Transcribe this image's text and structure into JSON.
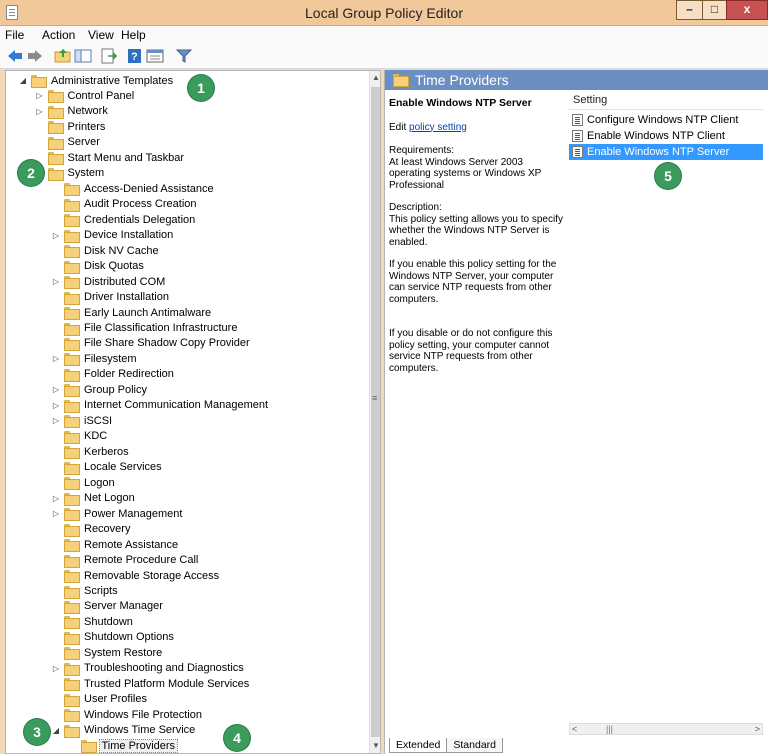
{
  "window": {
    "title": "Local Group Policy Editor"
  },
  "menu": [
    "File",
    "Action",
    "View",
    "Help"
  ],
  "toolbar": {
    "icons": [
      "back-arrow-icon",
      "forward-arrow-icon",
      "up-folder-icon",
      "show-hide-tree-icon",
      "export-list-icon",
      "help-icon",
      "properties-icon",
      "filter-icon"
    ]
  },
  "tree": [
    {
      "label": "Administrative Templates",
      "depth": 0,
      "expander": "expanded"
    },
    {
      "label": "Control Panel",
      "depth": 1,
      "expander": "collapsed"
    },
    {
      "label": "Network",
      "depth": 1,
      "expander": "collapsed"
    },
    {
      "label": "Printers",
      "depth": 1,
      "expander": ""
    },
    {
      "label": "Server",
      "depth": 1,
      "expander": ""
    },
    {
      "label": "Start Menu and Taskbar",
      "depth": 1,
      "expander": ""
    },
    {
      "label": "System",
      "depth": 1,
      "expander": "expanded"
    },
    {
      "label": "Access-Denied Assistance",
      "depth": 2,
      "expander": ""
    },
    {
      "label": "Audit Process Creation",
      "depth": 2,
      "expander": ""
    },
    {
      "label": "Credentials Delegation",
      "depth": 2,
      "expander": ""
    },
    {
      "label": "Device Installation",
      "depth": 2,
      "expander": "collapsed"
    },
    {
      "label": "Disk NV Cache",
      "depth": 2,
      "expander": ""
    },
    {
      "label": "Disk Quotas",
      "depth": 2,
      "expander": ""
    },
    {
      "label": "Distributed COM",
      "depth": 2,
      "expander": "collapsed"
    },
    {
      "label": "Driver Installation",
      "depth": 2,
      "expander": ""
    },
    {
      "label": "Early Launch Antimalware",
      "depth": 2,
      "expander": ""
    },
    {
      "label": "File Classification Infrastructure",
      "depth": 2,
      "expander": ""
    },
    {
      "label": "File Share Shadow Copy Provider",
      "depth": 2,
      "expander": ""
    },
    {
      "label": "Filesystem",
      "depth": 2,
      "expander": "collapsed"
    },
    {
      "label": "Folder Redirection",
      "depth": 2,
      "expander": ""
    },
    {
      "label": "Group Policy",
      "depth": 2,
      "expander": "collapsed"
    },
    {
      "label": "Internet Communication Management",
      "depth": 2,
      "expander": "collapsed"
    },
    {
      "label": "iSCSI",
      "depth": 2,
      "expander": "collapsed"
    },
    {
      "label": "KDC",
      "depth": 2,
      "expander": ""
    },
    {
      "label": "Kerberos",
      "depth": 2,
      "expander": ""
    },
    {
      "label": "Locale Services",
      "depth": 2,
      "expander": ""
    },
    {
      "label": "Logon",
      "depth": 2,
      "expander": ""
    },
    {
      "label": "Net Logon",
      "depth": 2,
      "expander": "collapsed"
    },
    {
      "label": "Power Management",
      "depth": 2,
      "expander": "collapsed"
    },
    {
      "label": "Recovery",
      "depth": 2,
      "expander": ""
    },
    {
      "label": "Remote Assistance",
      "depth": 2,
      "expander": ""
    },
    {
      "label": "Remote Procedure Call",
      "depth": 2,
      "expander": ""
    },
    {
      "label": "Removable Storage Access",
      "depth": 2,
      "expander": ""
    },
    {
      "label": "Scripts",
      "depth": 2,
      "expander": ""
    },
    {
      "label": "Server Manager",
      "depth": 2,
      "expander": ""
    },
    {
      "label": "Shutdown",
      "depth": 2,
      "expander": ""
    },
    {
      "label": "Shutdown Options",
      "depth": 2,
      "expander": ""
    },
    {
      "label": "System Restore",
      "depth": 2,
      "expander": ""
    },
    {
      "label": "Troubleshooting and Diagnostics",
      "depth": 2,
      "expander": "collapsed"
    },
    {
      "label": "Trusted Platform Module Services",
      "depth": 2,
      "expander": ""
    },
    {
      "label": "User Profiles",
      "depth": 2,
      "expander": ""
    },
    {
      "label": "Windows File Protection",
      "depth": 2,
      "expander": ""
    },
    {
      "label": "Windows Time Service",
      "depth": 2,
      "expander": "expanded"
    },
    {
      "label": "Time Providers",
      "depth": 3,
      "expander": "",
      "selected": true
    }
  ],
  "details": {
    "header": "Time Providers",
    "policy_title": "Enable Windows NTP Server",
    "edit_prefix": "Edit ",
    "edit_link": "policy setting",
    "requirements_label": "Requirements:",
    "requirements": "At least Windows Server 2003 operating systems or Windows XP Professional",
    "description_label": "Description:",
    "description_1": "This policy setting allows you to specify whether the Windows NTP Server is enabled.",
    "description_2": "If you enable this policy setting for the Windows NTP Server, your computer can service NTP requests from other computers.",
    "description_3": "If you disable or do not configure this policy setting, your computer cannot service NTP requests from other computers."
  },
  "settings": {
    "column_header": "Setting",
    "rows": [
      {
        "label": "Configure Windows NTP Client",
        "selected": false
      },
      {
        "label": "Enable Windows NTP Client",
        "selected": false
      },
      {
        "label": "Enable Windows NTP Server",
        "selected": true
      }
    ]
  },
  "tabs": [
    "Extended",
    "Standard"
  ],
  "callouts": [
    "1",
    "2",
    "3",
    "4",
    "5"
  ],
  "colors": {
    "header_blue": "#6b8fc2",
    "selection": "#3399ff",
    "callout_green": "#3a9b5d",
    "title_bar": "#f0c89a"
  }
}
